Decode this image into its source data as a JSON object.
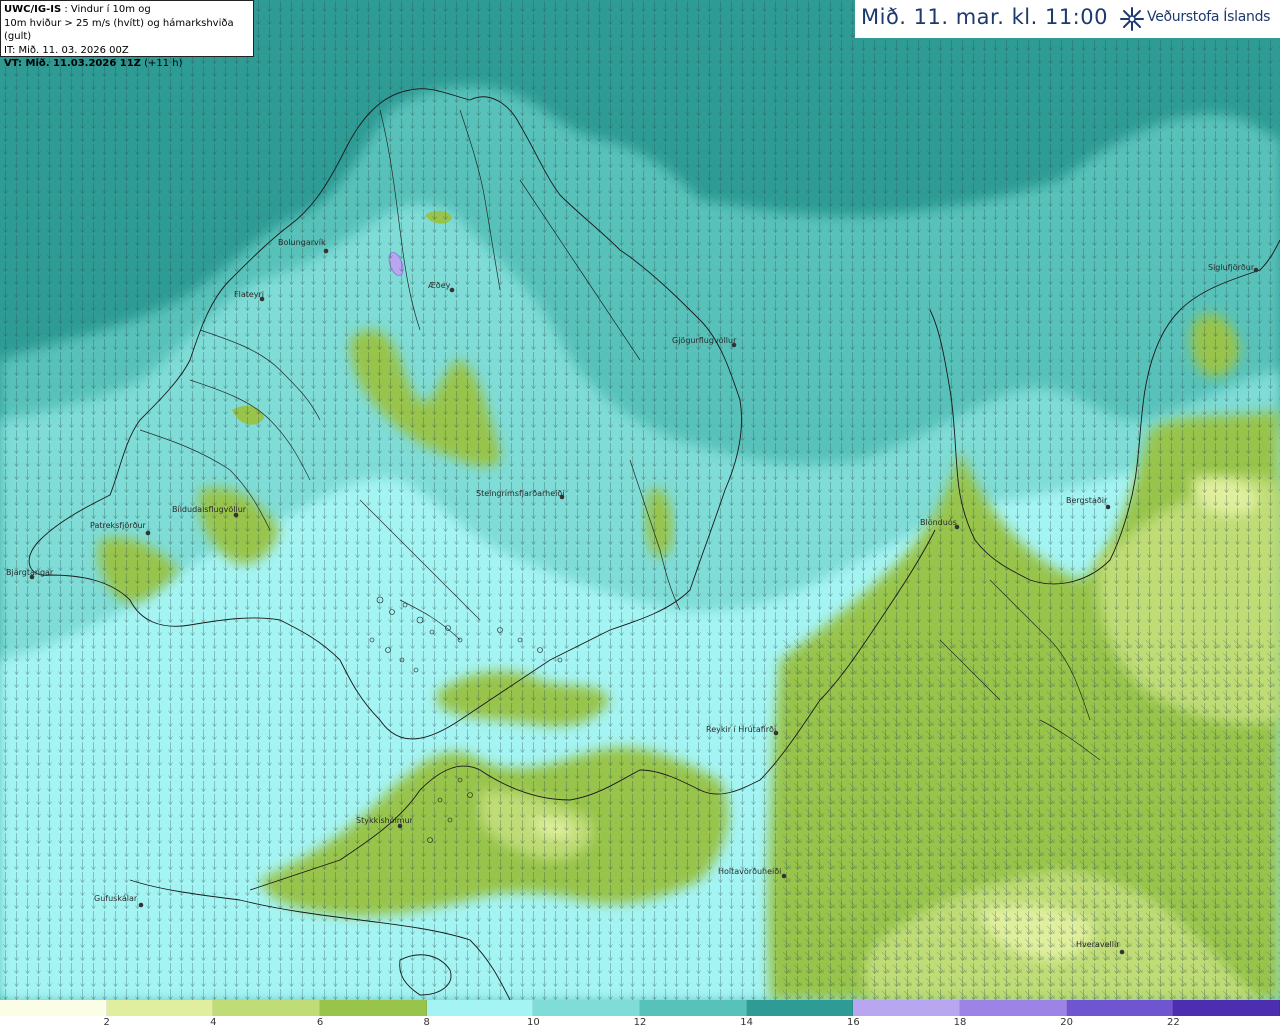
{
  "header": {
    "line1_bold": "UWC/IG-IS",
    "line1_rest": " : Vindur í 10m og",
    "line2": "10m hviður > 25 m/s (hvítt) og hámarkshviða (gult)",
    "line3": "IT: Mið. 11. 03. 2026 00Z",
    "line4_bold": "VT: Mið. 11.03.2026 11Z",
    "line4_rest": " (+11 h)"
  },
  "valid_time": "Mið. 11. mar. kl. 11:00",
  "brand": "Veðurstofa Íslands",
  "legend": {
    "colors": [
      "#fcfde6",
      "#e0ef9e",
      "#bfdc77",
      "#98c44b",
      "#a5f4f4",
      "#7fdcd7",
      "#58c2ba",
      "#2e9c95",
      "#b9a6f0",
      "#9b84e6",
      "#6f55cf",
      "#4b2fb0"
    ],
    "ticks": [
      "2",
      "4",
      "6",
      "8",
      "10",
      "12",
      "14",
      "16",
      "18",
      "20",
      "22"
    ]
  },
  "places": [
    {
      "name": "Bolungarvík"
    },
    {
      "name": "Flateyri"
    },
    {
      "name": "Æðey"
    },
    {
      "name": "Gjögurflugvöllur"
    },
    {
      "name": "Siglufjörður"
    },
    {
      "name": "Patreksfjörður"
    },
    {
      "name": "Bíldudalsflugvöllur"
    },
    {
      "name": "Bjargtangar"
    },
    {
      "name": "Steingrímsfjarðarheiði"
    },
    {
      "name": "Blönduós"
    },
    {
      "name": "Bergstaðir"
    },
    {
      "name": "Reykir í Hrútafirði"
    },
    {
      "name": "Stykkishólmur"
    },
    {
      "name": "Holtavörðuheiði"
    },
    {
      "name": "Gufuskálar"
    },
    {
      "name": "Hveravellir"
    }
  ]
}
